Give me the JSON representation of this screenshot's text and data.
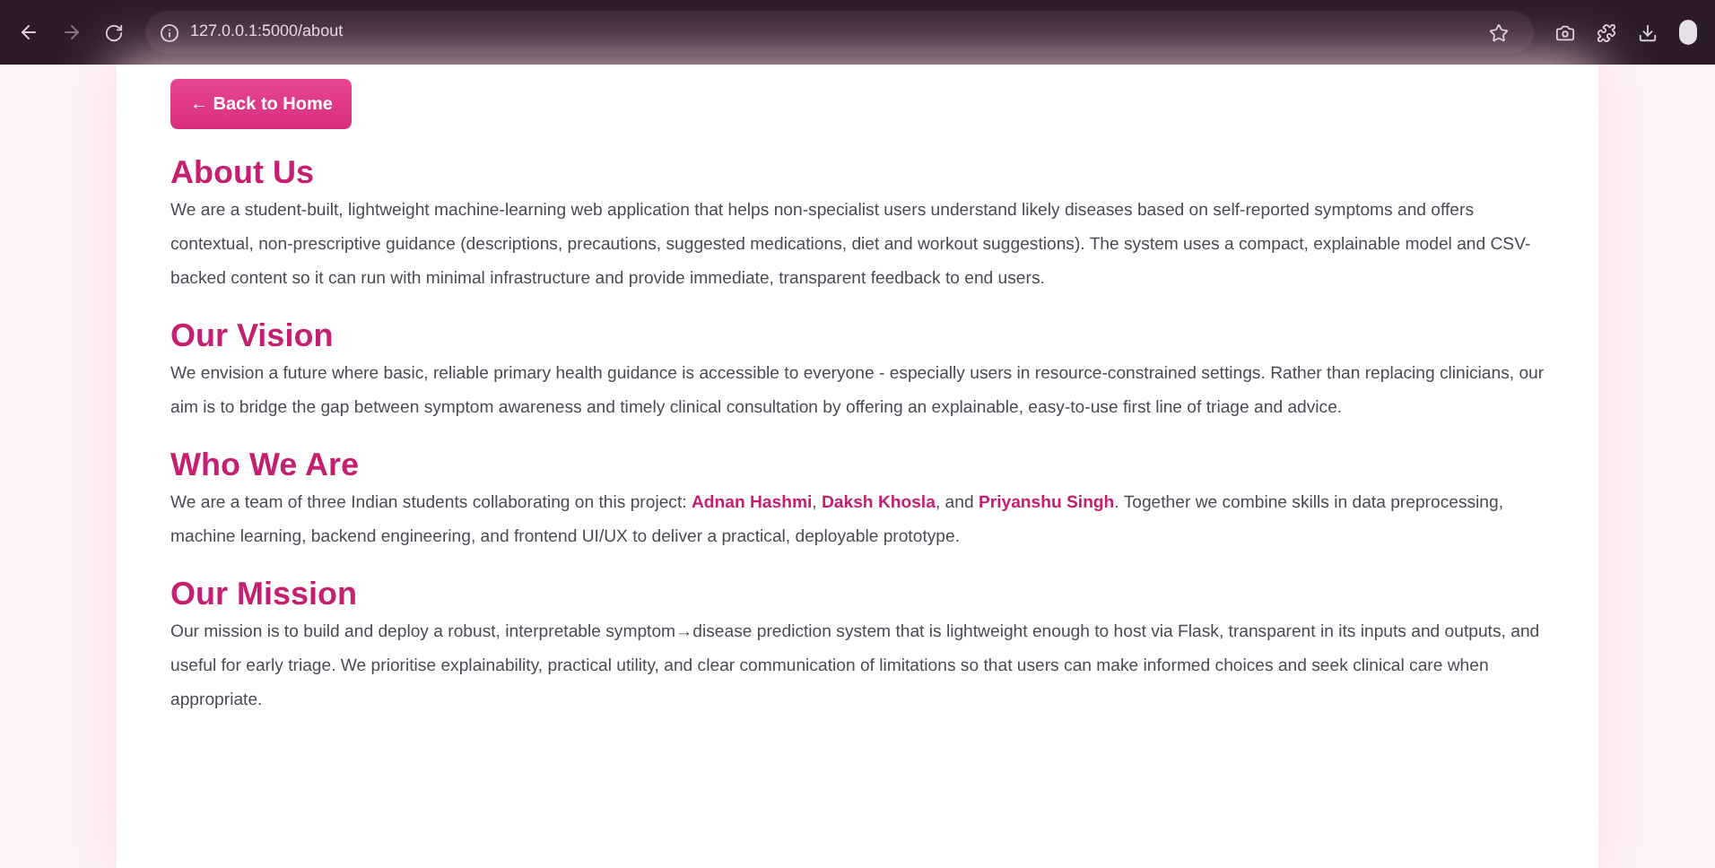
{
  "browser": {
    "url": "127.0.0.1:5000/about"
  },
  "back_button": {
    "label": "← Back to Home"
  },
  "sections": [
    {
      "heading": "About Us",
      "text": "We are a student-built, lightweight machine-learning web application that helps non-specialist users understand likely diseases based on self-reported symptoms and offers contextual, non-prescriptive guidance (descriptions, precautions, suggested medications, diet and workout suggestions). The system uses a compact, explainable model and CSV-backed content so it can run with minimal infrastructure and provide immediate, transparent feedback to end users."
    },
    {
      "heading": "Our Vision",
      "text": "We envision a future where basic, reliable primary health guidance is accessible to everyone - especially users in resource-constrained settings. Rather than replacing clinicians, our aim is to bridge the gap between symptom awareness and timely clinical consultation by offering an explainable, easy-to-use first line of triage and advice."
    },
    {
      "heading": "Who We Are",
      "text": "We are a team of three Indian students collaborating on this project: **Adnan Hashmi**, **Daksh Khosla**, and **Priyanshu Singh**. Together we combine skills in data preprocessing, machine learning, backend engineering, and frontend UI/UX to deliver a practical, deployable prototype."
    },
    {
      "heading": "Our Mission",
      "text": "Our mission is to build and deploy a robust, interpretable symptom→disease prediction system that is lightweight enough to host via Flask, transparent in its inputs and outputs, and useful for early triage. We prioritise explainability, practical utility, and clear communication of limitations so that users can make informed choices and seek clinical care when appropriate."
    }
  ]
}
